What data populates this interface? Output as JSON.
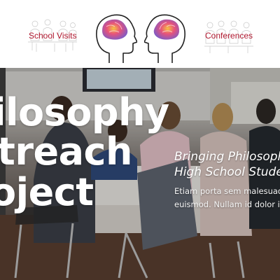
{
  "nav": {
    "school_visits": "School Visits",
    "conferences": "Conferences"
  },
  "icons": {
    "left_head": "brain-head-icon",
    "right_head": "brain-head-icon",
    "left_sketch": "students-sketch",
    "right_sketch": "audience-sketch"
  },
  "hero": {
    "title_line1": "ilosophy",
    "title_line2": "treach",
    "title_line3": "oject",
    "subtitle_line1": "Bringing Philosophy",
    "subtitle_line2": "High School Student",
    "body_line1": "Etiam porta sem malesuada",
    "body_line2": "euismod. Nullam id dolor id"
  },
  "colors": {
    "nav_link": "#b0172e",
    "title": "#ffffff"
  }
}
